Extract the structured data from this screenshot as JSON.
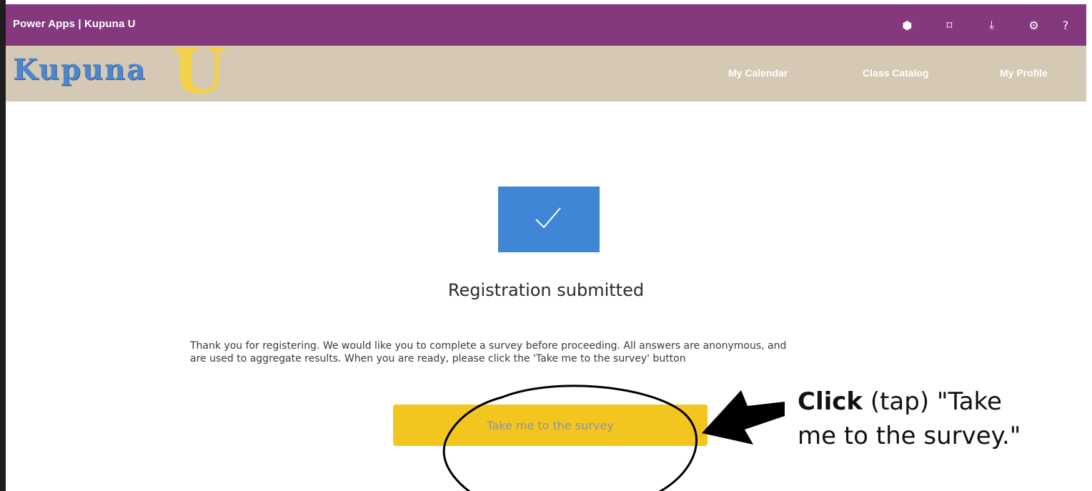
{
  "window": {
    "title": "Power Apps | Kupuna U",
    "icons": [
      {
        "name": "teams-icon",
        "glyph": "⬢"
      },
      {
        "name": "fit-screen-icon",
        "glyph": "⌑"
      },
      {
        "name": "download-icon",
        "glyph": "⤓"
      },
      {
        "name": "settings-icon",
        "glyph": "⚙"
      },
      {
        "name": "help-icon",
        "glyph": "?"
      }
    ],
    "bar_color": "#84387d"
  },
  "header": {
    "logo_text": "Kupuna",
    "logo_letter": "U",
    "nav": [
      "My Calendar",
      "Class Catalog",
      "My Profile"
    ],
    "bar_color": "#d5c9b5"
  },
  "main": {
    "status_icon": "checkmark-icon",
    "heading": "Registration submitted",
    "message_line1": "Thank you for registering. We would like you to complete a survey before proceeding. All answers are anonymous, and",
    "message_line2": "are used to aggregate results. When you are ready, please click the 'Take me to the survey' button",
    "button_label": "Take me to the survey",
    "tile_color": "#3f86d6",
    "button_color": "#f3c61f"
  },
  "annotation": {
    "bold": "Click",
    "rest_line1": " (tap) \"Take",
    "line2": "me to the survey.\""
  }
}
